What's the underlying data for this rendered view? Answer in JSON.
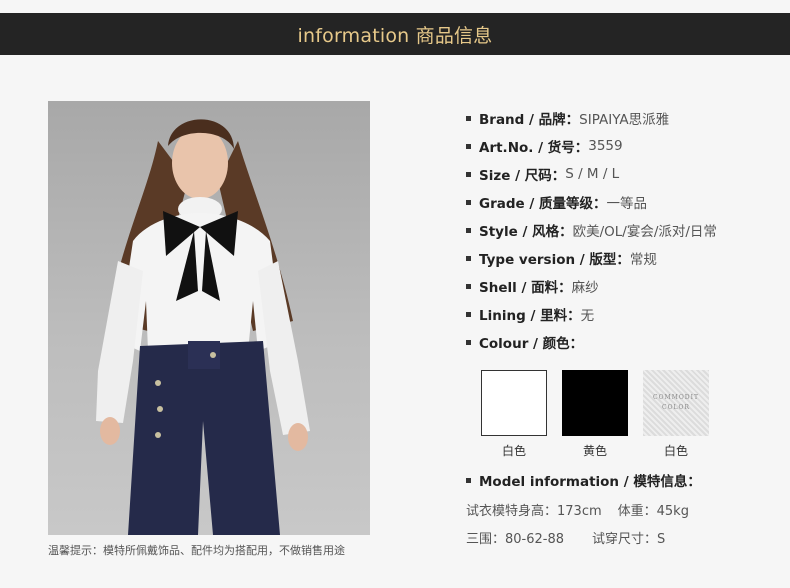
{
  "header": {
    "title": "information 商品信息"
  },
  "caption": "温馨提示：模特所佩戴饰品、配件均为搭配用，不做销售用途",
  "specs": [
    {
      "label": "Brand / 品牌：",
      "value": "SIPAIYA思派雅"
    },
    {
      "label": "Art.No. / 货号：",
      "value": "3559"
    },
    {
      "label": "Size / 尺码：",
      "value": "S / M / L"
    },
    {
      "label": "Grade / 质量等级：",
      "value": "一等品"
    },
    {
      "label": "Style / 风格：",
      "value": "欧美/OL/宴会/派对/日常"
    },
    {
      "label": "Type version / 版型：",
      "value": "常规"
    },
    {
      "label": "Shell / 面料：",
      "value": "麻纱"
    },
    {
      "label": "Lining / 里料：",
      "value": "无"
    },
    {
      "label": "Colour / 颜色：",
      "value": ""
    }
  ],
  "swatches": [
    {
      "label": "白色",
      "color": "#ffffff"
    },
    {
      "label": "黄色",
      "color": "#000000"
    },
    {
      "label": "白色",
      "color": "#e8e8e8",
      "text_line1": "COMMODIT",
      "text_line2": "COLOR"
    }
  ],
  "model": {
    "heading": "Model information / 模特信息：",
    "height": "试衣模特身高：173cm",
    "weight": "体重：45kg",
    "measurements": "三围：80-62-88",
    "size_worn": "试穿尺寸：S"
  }
}
